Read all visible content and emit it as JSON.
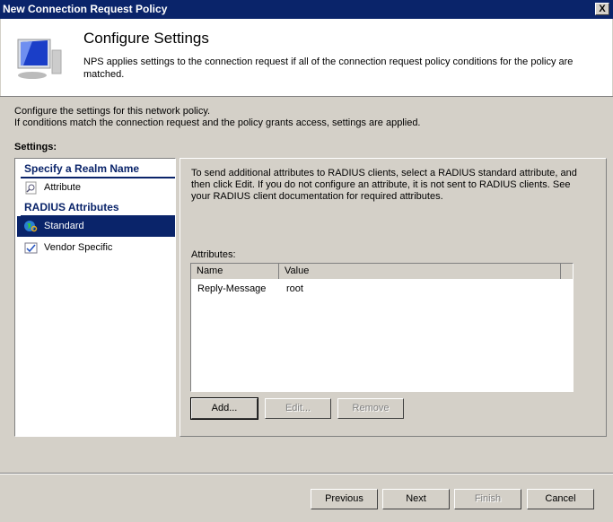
{
  "window": {
    "title": "New Connection Request Policy",
    "close": "X"
  },
  "header": {
    "title": "Configure Settings",
    "description": "NPS applies settings to the connection request if all of the connection request policy conditions  for the policy are matched."
  },
  "intro": {
    "line1": "Configure the settings for this network policy.",
    "line2": "If conditions match the connection request and the policy grants access, settings are applied."
  },
  "settings_label": "Settings:",
  "sidebar": {
    "groups": [
      {
        "label": "Specify a Realm Name"
      },
      {
        "label": "RADIUS Attributes"
      }
    ],
    "items": [
      {
        "label": "Attribute",
        "icon": "magnifier-icon"
      },
      {
        "label": "Standard",
        "icon": "globe-key-icon",
        "selected": true
      },
      {
        "label": "Vendor Specific",
        "icon": "checkbox-icon"
      }
    ]
  },
  "panel": {
    "description": "To send additional attributes to RADIUS clients, select a RADIUS standard attribute, and then click Edit. If you do not configure an attribute, it is not sent to RADIUS clients. See your RADIUS client documentation for required attributes.",
    "attributes_label": "Attributes:",
    "columns": [
      "Name",
      "Value"
    ],
    "rows": [
      {
        "name": "Reply-Message",
        "value": "root"
      }
    ],
    "buttons": {
      "add": "Add...",
      "edit": "Edit...",
      "remove": "Remove"
    }
  },
  "footer": {
    "previous": "Previous",
    "next": "Next",
    "finish": "Finish",
    "cancel": "Cancel"
  }
}
